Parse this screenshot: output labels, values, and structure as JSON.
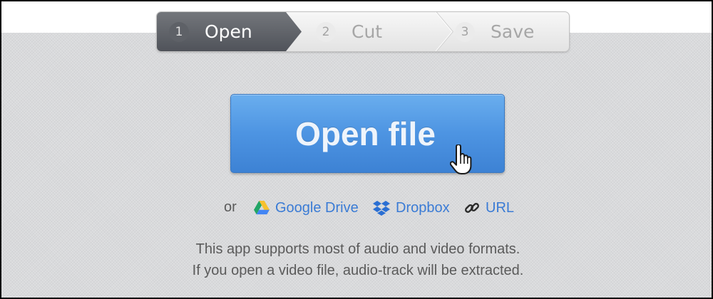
{
  "steps": [
    {
      "num": "1",
      "label": "Open",
      "state": "active"
    },
    {
      "num": "2",
      "label": "Cut",
      "state": "inactive"
    },
    {
      "num": "3",
      "label": "Save",
      "state": "inactive"
    }
  ],
  "main": {
    "open_button_label": "Open file"
  },
  "sources": {
    "or_label": "or",
    "google_drive_label": "Google Drive",
    "dropbox_label": "Dropbox",
    "url_label": "URL"
  },
  "info": {
    "line1": "This app supports most of audio and video formats.",
    "line2": "If you open a video file, audio-track will be extracted."
  },
  "icons": {
    "google_drive": "google-drive-icon",
    "dropbox": "dropbox-icon",
    "url": "link-icon",
    "cursor": "hand-pointer-icon"
  },
  "colors": {
    "button_blue": "#4d94e2",
    "link_blue": "#3a7bd5",
    "active_step": "#5e6167"
  }
}
